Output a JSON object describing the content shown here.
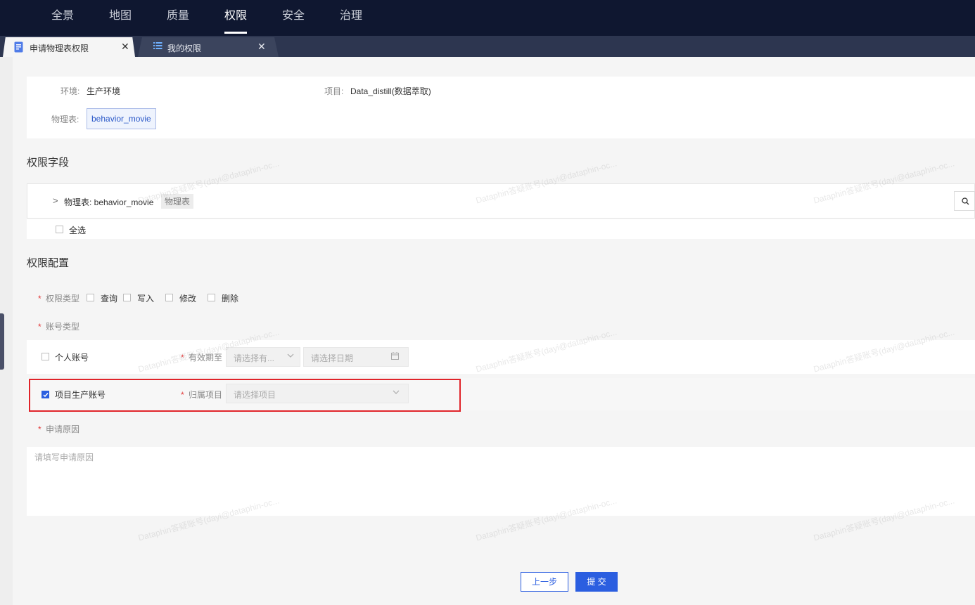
{
  "nav": {
    "items": [
      {
        "label": "全景"
      },
      {
        "label": "地图"
      },
      {
        "label": "质量"
      },
      {
        "label": "权限"
      },
      {
        "label": "安全"
      },
      {
        "label": "治理"
      }
    ],
    "active": "权限"
  },
  "tabs": [
    {
      "label": "申请物理表权限",
      "icon": "document-icon",
      "active": true
    },
    {
      "label": "我的权限",
      "icon": "list-icon",
      "active": false
    }
  ],
  "info": {
    "env_label": "环境:",
    "env_value": "生产环境",
    "project_label": "项目:",
    "project_value": "Data_distill(数据萃取)",
    "table_label": "物理表:",
    "table_value": "behavior_movie"
  },
  "fields_section": {
    "title": "权限字段",
    "table_row_text": "物理表: behavior_movie",
    "table_tag": "物理表",
    "select_all": "全选"
  },
  "config_section": {
    "title": "权限配置",
    "perm_type_label": "权限类型",
    "perm_options": [
      "查询",
      "写入",
      "修改",
      "删除"
    ],
    "account_type_label": "账号类型",
    "personal_account": "个人账号",
    "valid_until_label": "有效期至",
    "valid_select_placeholder": "请选择有...",
    "date_placeholder": "请选择日期",
    "project_account": "项目生产账号",
    "belong_project_label": "归属项目",
    "belong_project_placeholder": "请选择项目",
    "reason_label": "申请原因",
    "reason_placeholder": "请填写申请原因"
  },
  "buttons": {
    "prev": "上一步",
    "submit": "提 交"
  },
  "watermark": "Dataphin答疑账号(dayi@dataphin-oc...",
  "colors": {
    "nav_bg": "#0f1730",
    "tabbar_bg": "#2d3650",
    "primary": "#2b5ee0",
    "highlight_box": "#e0242a",
    "required": "#e23a3a"
  }
}
